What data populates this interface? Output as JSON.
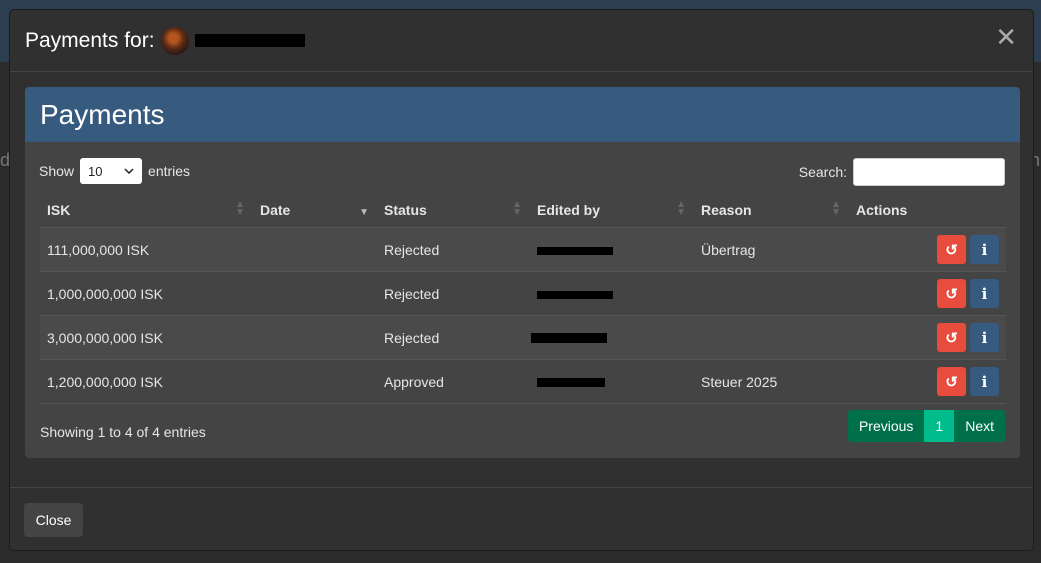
{
  "modal": {
    "title_prefix": "Payments for:",
    "close_symbol": "✕",
    "close_button": "Close"
  },
  "card": {
    "title": "Payments",
    "show_label": "Show",
    "entries_label": "entries",
    "page_length": "10",
    "search_label": "Search:"
  },
  "table": {
    "headers": [
      "ISK",
      "Date",
      "Status",
      "Edited by",
      "Reason",
      "Actions"
    ],
    "rows": [
      {
        "isk": "111,000,000 ISK",
        "date": "",
        "status": "Rejected",
        "reason": "Übertrag"
      },
      {
        "isk": "1,000,000,000 ISK",
        "date": "",
        "status": "Rejected",
        "reason": ""
      },
      {
        "isk": "3,000,000,000 ISK",
        "date": "",
        "status": "Rejected",
        "reason": ""
      },
      {
        "isk": "1,200,000,000 ISK",
        "date": "",
        "status": "Approved",
        "reason": "Steuer 2025"
      }
    ]
  },
  "footer": {
    "info": "Showing 1 to 4 of 4 entries",
    "previous": "Previous",
    "current_page": "1",
    "next": "Next"
  },
  "icons": {
    "undo": "undo-icon",
    "info": "info-icon"
  },
  "colors": {
    "header_blue": "#375a7f",
    "danger": "#e74c3c",
    "success": "#00bc8c"
  }
}
